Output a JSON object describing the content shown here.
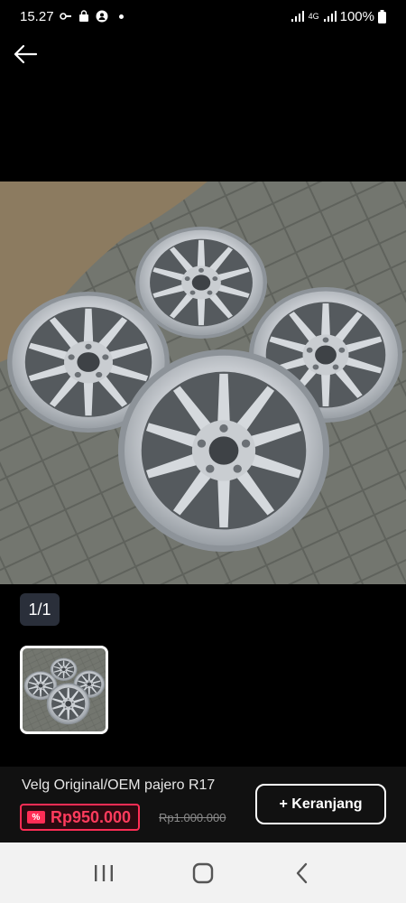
{
  "status_bar": {
    "time": "15.27",
    "network": "4G",
    "battery": "100%"
  },
  "gallery": {
    "counter": "1/1"
  },
  "product": {
    "title": "Velg Original/OEM pajero R17",
    "price": "Rp950.000",
    "original_price": "Rp1.000.000",
    "add_to_cart_label": "+ Keranjang"
  },
  "colors": {
    "accent_red": "#ff2d55",
    "background": "#000000",
    "nav_background": "#f2f2f2"
  }
}
